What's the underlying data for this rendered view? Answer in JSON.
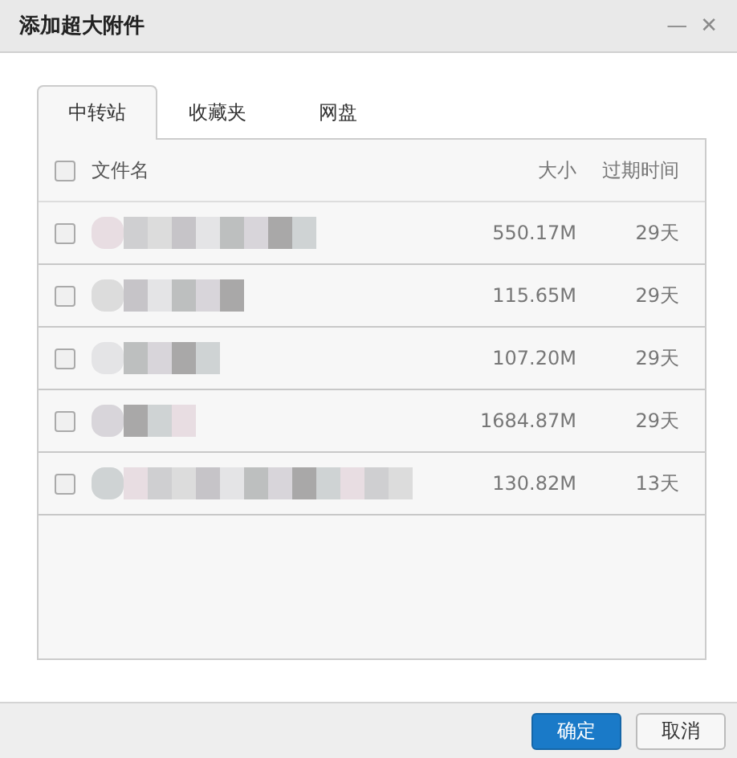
{
  "window": {
    "title": "添加超大附件",
    "controls": [
      "—",
      "✕"
    ]
  },
  "tabs": [
    {
      "label": "中转站",
      "selected": true
    },
    {
      "label": "收藏夹",
      "selected": false
    },
    {
      "label": "网盘",
      "selected": false
    }
  ],
  "table": {
    "select_all": {
      "checked": false
    },
    "columns": [
      "文件名",
      "大小",
      "过期时间"
    ],
    "rows": [
      {
        "checked": false,
        "size": "550.17M",
        "expires": "29天"
      },
      {
        "checked": false,
        "size": "115.65M",
        "expires": "29天"
      },
      {
        "checked": false,
        "size": "107.20M",
        "expires": "29天"
      },
      {
        "checked": false,
        "size": "1684.87M",
        "expires": "29天"
      },
      {
        "checked": false,
        "size": "130.82M",
        "expires": "13天"
      }
    ]
  },
  "buttons": [
    {
      "label": "确定",
      "kind": "primary"
    },
    {
      "label": "取消",
      "kind": "secondary"
    }
  ]
}
